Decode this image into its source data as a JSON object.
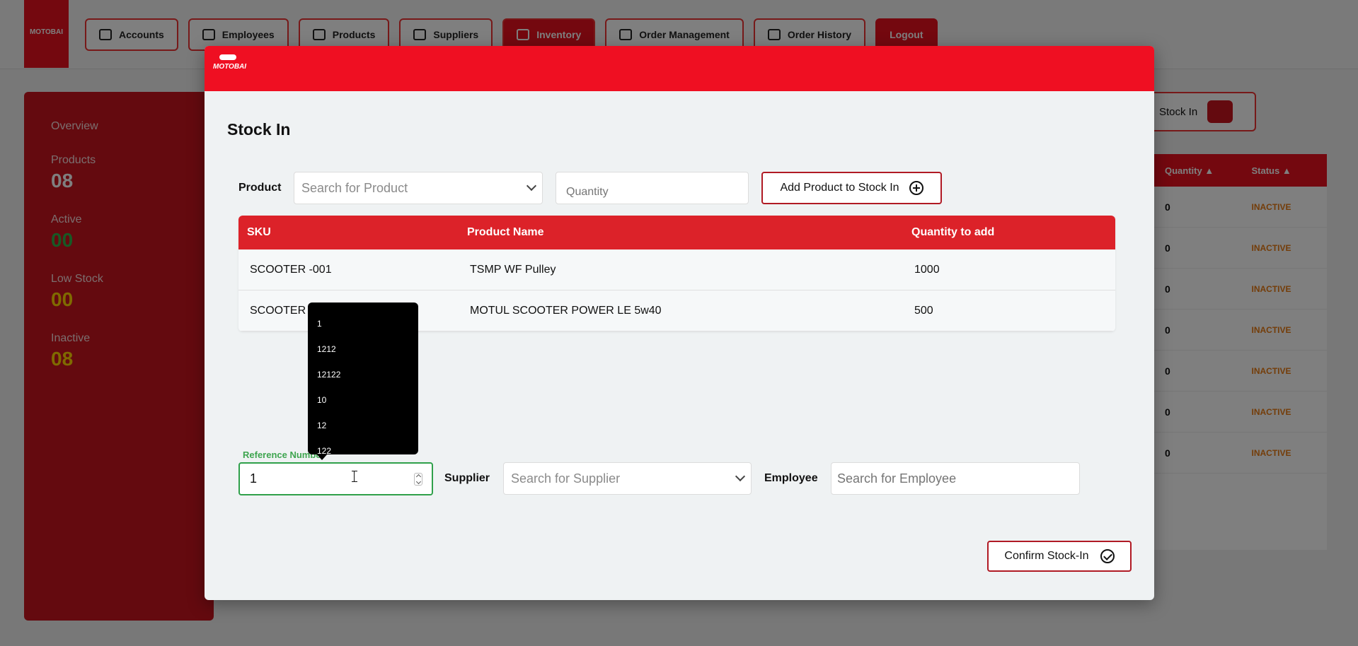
{
  "background": {
    "logo_text": "MOTOBAI",
    "nav": [
      {
        "label": "Accounts"
      },
      {
        "label": "Employees"
      },
      {
        "label": "Products"
      },
      {
        "label": "Suppliers"
      },
      {
        "label": "Inventory"
      },
      {
        "label": "Order Management"
      },
      {
        "label": "Order History"
      },
      {
        "label": "Logout"
      }
    ],
    "overview": {
      "title": "Overview",
      "stats": [
        {
          "label": "Products",
          "value": "08"
        },
        {
          "label": "Active",
          "value": "00"
        },
        {
          "label": "Low Stock",
          "value": "00"
        },
        {
          "label": "Inactive",
          "value": "08"
        }
      ]
    },
    "stock_in_button": "Stock In",
    "table_headers": [
      "Quantity ▲",
      "Status ▲"
    ],
    "rows": [
      {
        "qty": "0",
        "status": "INACTIVE"
      },
      {
        "qty": "0",
        "status": "INACTIVE"
      },
      {
        "qty": "0",
        "status": "INACTIVE"
      },
      {
        "qty": "0",
        "status": "INACTIVE"
      },
      {
        "qty": "0",
        "status": "INACTIVE"
      },
      {
        "qty": "0",
        "status": "INACTIVE"
      },
      {
        "qty": "0",
        "status": "INACTIVE"
      }
    ]
  },
  "modal": {
    "brand": "MOTOBAI",
    "title": "Stock In",
    "product_label": "Product",
    "product_placeholder": "Search for Product",
    "quantity_placeholder": "Quantity",
    "add_button": "Add Product to Stock In",
    "table": {
      "headers": {
        "sku": "SKU",
        "name": "Product Name",
        "qty": "Quantity to add"
      },
      "rows": [
        {
          "sku": "SCOOTER -001",
          "name": "TSMP WF Pulley",
          "qty": "1000"
        },
        {
          "sku": "SCOOTER",
          "name": "MOTUL SCOOTER POWER LE 5w40",
          "qty": "500"
        }
      ]
    },
    "reference_label": "Reference Number",
    "reference_value": "1",
    "autocomplete": [
      "1",
      "1212",
      "12122",
      "10",
      "12",
      "122"
    ],
    "supplier_label": "Supplier",
    "supplier_placeholder": "Search for Supplier",
    "employee_label": "Employee",
    "employee_placeholder": "Search for Employee",
    "confirm_button": "Confirm Stock-In"
  },
  "colors": {
    "brand_red": "#ef0f22",
    "table_header_red": "#dc2229",
    "button_border": "#b01a24",
    "focus_green": "#2fa04a"
  }
}
